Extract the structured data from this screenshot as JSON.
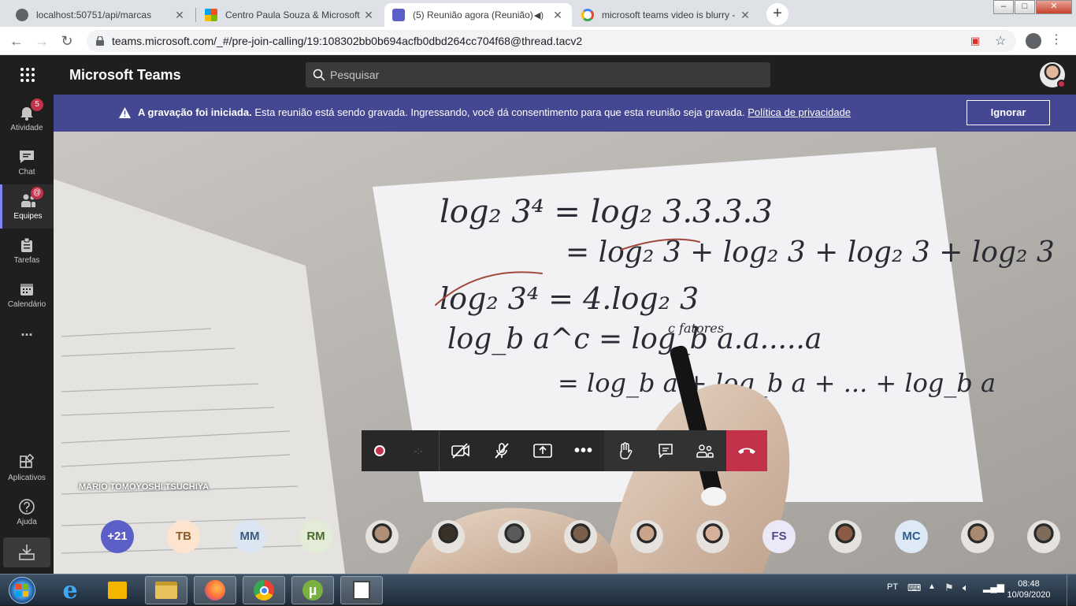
{
  "browser": {
    "tabs": [
      {
        "title": "localhost:50751/api/marcas",
        "active": false
      },
      {
        "title": "Centro Paula Souza & Microsoft",
        "active": false
      },
      {
        "title": "(5) Reunião agora (Reunião)",
        "active": true
      },
      {
        "title": "microsoft teams video is blurry -",
        "active": false
      }
    ],
    "new_tab_label": "+",
    "url": "teams.microsoft.com/_#/pre-join-calling/19:108302bb0b694acfb0dbd264cc704f68@thread.tacv2",
    "window_controls": [
      "–",
      "□",
      "✕"
    ]
  },
  "teams": {
    "app_name": "Microsoft Teams",
    "search_placeholder": "Pesquisar",
    "rail": [
      {
        "label": "Atividade",
        "icon": "bell-icon",
        "badge": "5"
      },
      {
        "label": "Chat",
        "icon": "chat-icon"
      },
      {
        "label": "Equipes",
        "icon": "teams-icon",
        "badge": "@",
        "selected": true
      },
      {
        "label": "Tarefas",
        "icon": "tasks-icon"
      },
      {
        "label": "Calendário",
        "icon": "calendar-icon"
      },
      {
        "label": "...",
        "icon": "more-icon"
      }
    ],
    "rail_bottom": [
      {
        "label": "Aplicativos",
        "icon": "apps-icon"
      },
      {
        "label": "Ajuda",
        "icon": "help-icon"
      }
    ],
    "banner": {
      "bold": "A gravação foi iniciada.",
      "text": "Esta reunião está sendo gravada. Ingressando, você dá consentimento para que esta reunião seja gravada.",
      "link": "Política de privacidade",
      "button": "Ignorar"
    },
    "presenter_name": "MARIO TOMOYOSHI TSUCHIYA",
    "participants": [
      {
        "initials": "+21",
        "color": "#5b5fc7",
        "fg": "#ffffff"
      },
      {
        "initials": "TB",
        "color": "#fce4cf",
        "fg": "#8a5a2b"
      },
      {
        "initials": "MM",
        "color": "#dbe6f2",
        "fg": "#3b5c80"
      },
      {
        "initials": "RM",
        "color": "#e2ecd7",
        "fg": "#4a6a2f"
      },
      {
        "initials": "",
        "photo": true
      },
      {
        "initials": "",
        "photo": true
      },
      {
        "initials": "",
        "photo": true
      },
      {
        "initials": "",
        "photo": true
      },
      {
        "initials": "",
        "photo": true
      },
      {
        "initials": "",
        "photo": true
      },
      {
        "initials": "FS",
        "color": "#ebe8f7",
        "fg": "#4f4a8a"
      },
      {
        "initials": "",
        "photo": true
      },
      {
        "initials": "MC",
        "color": "#dde9f5",
        "fg": "#2f5d87"
      },
      {
        "initials": "",
        "photo": true
      },
      {
        "initials": "",
        "photo": true
      }
    ],
    "whiteboard_lines": [
      "log₂ 3⁴ = log₂ 3.3.3.3",
      "= log₂ 3 + log₂ 3 + log₂ 3 + log₂ 3",
      "log₂ 3⁴ = 4.log₂ 3",
      "log_b a^c = log_b a.a.....a",
      "c fatores",
      "= log_b a + log_b a + ... + log_b a"
    ]
  },
  "taskbar": {
    "lang": "PT",
    "time": "08:48",
    "date": "10/09/2020"
  }
}
